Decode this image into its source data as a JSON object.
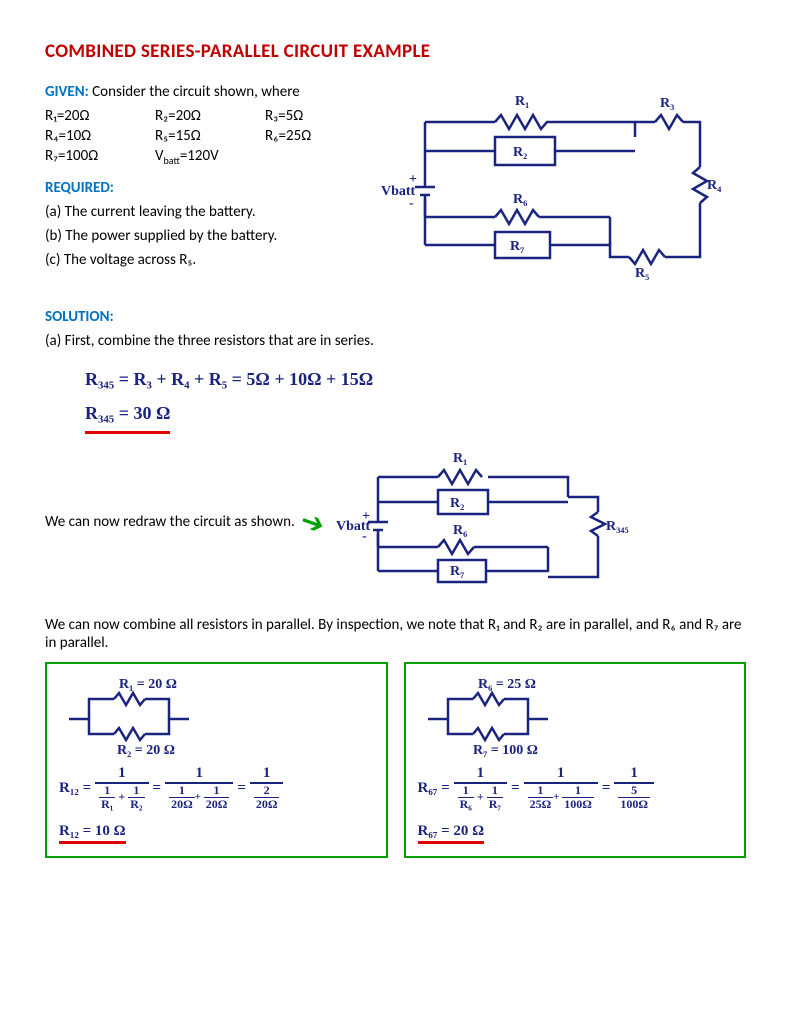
{
  "title": "COMBINED SERIES-PARALLEL CIRCUIT EXAMPLE",
  "given": {
    "label": "GIVEN:",
    "intro": "Consider the circuit shown, where",
    "r1": "R₁=20Ω",
    "r2": "R₂=20Ω",
    "r3": "R₃=5Ω",
    "r4": "R₄=10Ω",
    "r5": "R₅=15Ω",
    "r6": "R₆=25Ω",
    "r7": "R₇=100Ω",
    "vbatt": "Vbatt=120V"
  },
  "required": {
    "label": "REQUIRED:",
    "a": "(a) The current leaving the battery.",
    "b": "(b) The power supplied by the battery.",
    "c": "(c) The voltage across R₅."
  },
  "solution": {
    "label": "SOLUTION:",
    "a_text": "(a) First, combine the three resistors that are in series.",
    "eq1": "R₃₄₅  =  R₃ + R₄ + R₅  =  5Ω + 10Ω + 15Ω",
    "eq1_result": "R₃₄₅ =  30 Ω",
    "redraw": "We can now redraw the circuit as shown.",
    "parallel_text": "We can now combine all resistors in parallel. By inspection, we note that R₁ and R₂ are in parallel, and R₆ and R₇ are in parallel."
  },
  "circuit1": {
    "vbatt": "Vbatt",
    "r1": "R₁",
    "r2": "R₂",
    "r3": "R₃",
    "r4": "R₄",
    "r5": "R₅",
    "r6": "R₆",
    "r7": "R₇"
  },
  "circuit2": {
    "vbatt": "Vbatt",
    "r1": "R₁",
    "r2": "R₂",
    "r345": "R₃₄₅",
    "r6": "R₆",
    "r7": "R₇"
  },
  "box_left": {
    "r1": "R₁ = 20 Ω",
    "r2": "R₂ = 20 Ω",
    "r12_label": "R₁₂ =",
    "frac1_d": "1/R₁  +  1/R₂",
    "frac2_d": "1/20Ω + 1/20Ω",
    "frac3_d": "2/20Ω",
    "result": "R₁₂ =  10 Ω"
  },
  "box_right": {
    "r6": "R₆ = 25 Ω",
    "r7": "R₇ = 100 Ω",
    "r67_label": "R₆₇ =",
    "frac1_d": "1/R₆  +  1/R₇",
    "frac2_d": "1/25Ω + 1/100Ω",
    "frac3_d": "5/100Ω",
    "result": "R₆₇ = 20 Ω"
  }
}
